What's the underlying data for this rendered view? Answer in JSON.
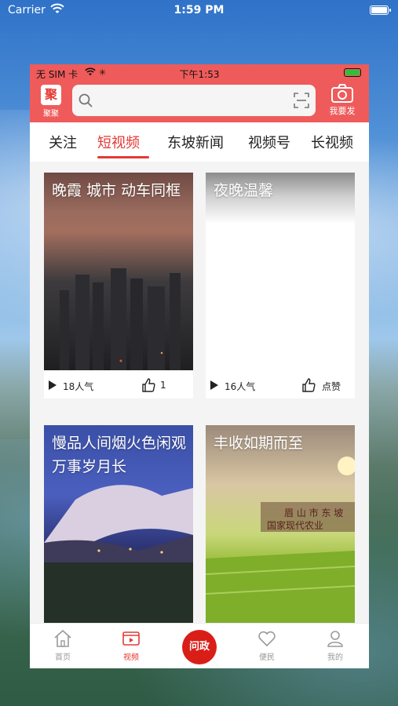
{
  "ios_status": {
    "carrier": "Carrier",
    "time": "1:59 PM"
  },
  "app_status": {
    "sim": "无 SIM 卡",
    "time": "下午1:53"
  },
  "header": {
    "logo_text": "聚",
    "logo_label": "聚聚",
    "search_placeholder": "",
    "camera_label": "我要发"
  },
  "tabs": [
    {
      "label": "关注",
      "active": false
    },
    {
      "label": "短视频",
      "active": true
    },
    {
      "label": "东坡新闻",
      "active": false
    },
    {
      "label": "视频号",
      "active": false
    },
    {
      "label": "长视频",
      "active": false
    }
  ],
  "cards": [
    {
      "title": "晚霞  城市  动车同框",
      "views": "18人气",
      "likes": "1"
    },
    {
      "title": "夜晚温馨",
      "views": "16人气",
      "likes": "点赞"
    },
    {
      "title": "慢品人间烟火色闲观万事岁月长"
    },
    {
      "title": "丰收如期而至",
      "sign_line1": "眉 山 市 东 坡",
      "sign_line2": "国家现代农业"
    }
  ],
  "bottom_nav": [
    {
      "label": "首页",
      "icon": "home-icon",
      "active": false
    },
    {
      "label": "视频",
      "icon": "video-icon",
      "active": true
    },
    {
      "label": "问政",
      "icon": "wenzheng-logo",
      "active": false
    },
    {
      "label": "便民",
      "icon": "heart-icon",
      "active": false
    },
    {
      "label": "我的",
      "icon": "user-icon",
      "active": false
    }
  ],
  "colors": {
    "brand_red": "#ef5b5b",
    "accent_red": "#e53935"
  }
}
